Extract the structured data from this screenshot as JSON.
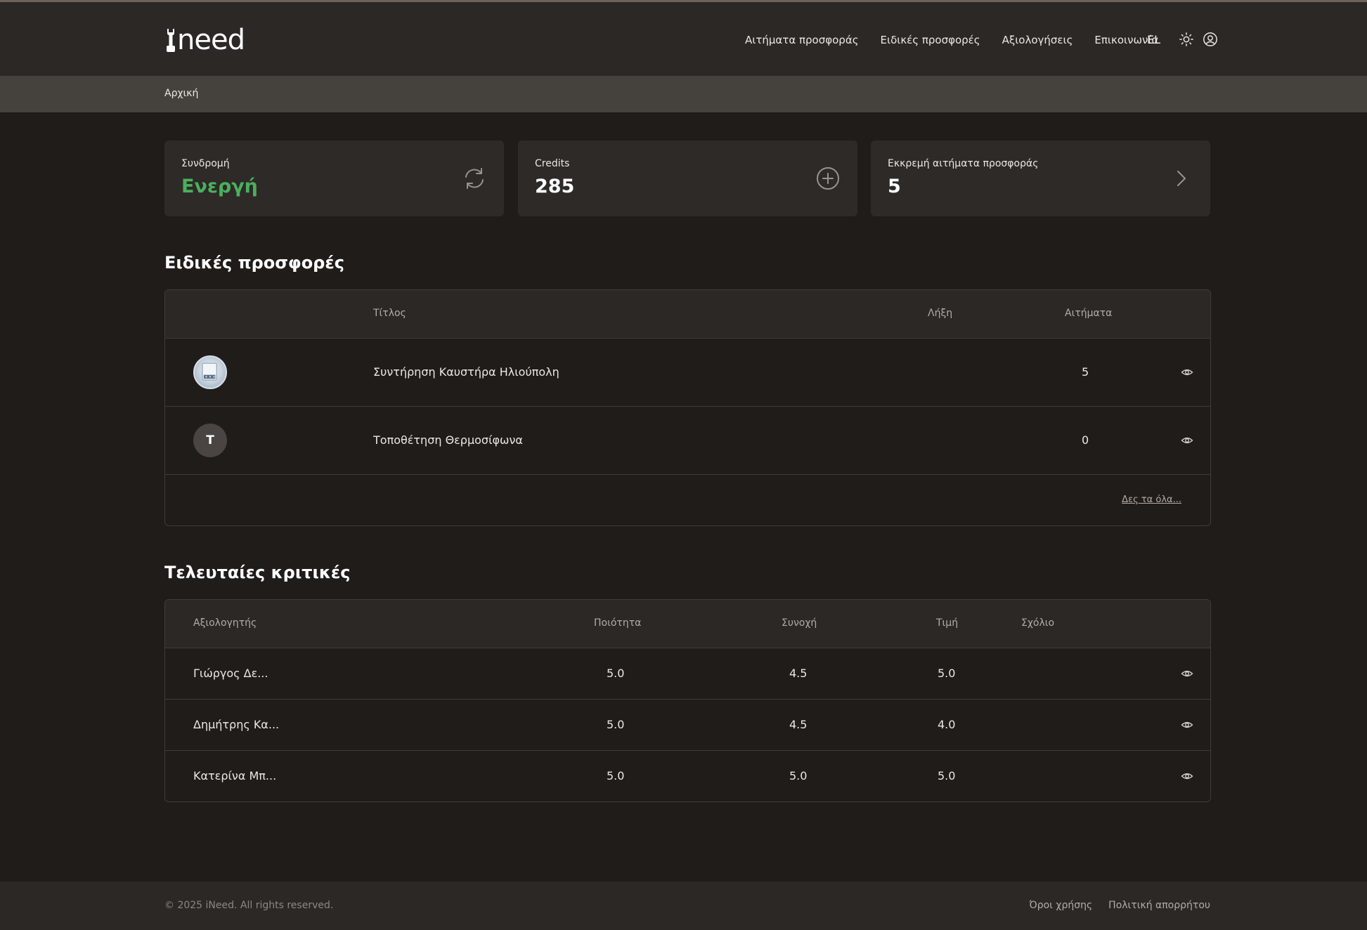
{
  "brand": {
    "logo_text": "need"
  },
  "nav": {
    "links": [
      "Αιτήματα προσφοράς",
      "Ειδικές προσφορές",
      "Αξιολογήσεις",
      "Επικοινωνία"
    ],
    "language": "EL"
  },
  "breadcrumb": "Αρχική",
  "cards": {
    "subscription": {
      "label": "Συνδρομή",
      "value": "Ενεργή",
      "value_color": "#4caf5d",
      "icon": "refresh-icon"
    },
    "credits": {
      "label": "Credits",
      "value": "285",
      "icon": "plus-circle-icon"
    },
    "pending": {
      "label": "Εκκρεμή αιτήματα προσφοράς",
      "value": "5",
      "icon": "chevron-right-icon"
    }
  },
  "offers": {
    "title": "Ειδικές προσφορές",
    "headers": {
      "title": "Τίτλος",
      "expiry": "Λήξη",
      "requests": "Αιτήματα"
    },
    "rows": [
      {
        "avatar": "image",
        "title": "Συντήρηση Καυστήρα Ηλιούπολη",
        "expiry": "",
        "requests": "5"
      },
      {
        "avatar": "T",
        "title": "Τοποθέτηση Θερμοσίφωνα",
        "expiry": "",
        "requests": "0"
      }
    ],
    "see_all": "Δες τα όλα..."
  },
  "reviews": {
    "title": "Τελευταίες κριτικές",
    "headers": {
      "reviewer": "Αξιολογητής",
      "quality": "Ποιότητα",
      "consistency": "Συνοχή",
      "price": "Τιμή",
      "comment": "Σχόλιο"
    },
    "rows": [
      {
        "reviewer": "Γιώργος Δε...",
        "quality": "5.0",
        "consistency": "4.5",
        "price": "5.0",
        "comment": ""
      },
      {
        "reviewer": "Δημήτρης Κα...",
        "quality": "5.0",
        "consistency": "4.5",
        "price": "4.0",
        "comment": ""
      },
      {
        "reviewer": "Κατερίνα Μπ...",
        "quality": "5.0",
        "consistency": "5.0",
        "price": "5.0",
        "comment": ""
      }
    ]
  },
  "footer": {
    "copyright": "© 2025 iNeed. All rights reserved.",
    "links": [
      "Όροι χρήσης",
      "Πολιτική απορρήτου"
    ]
  }
}
